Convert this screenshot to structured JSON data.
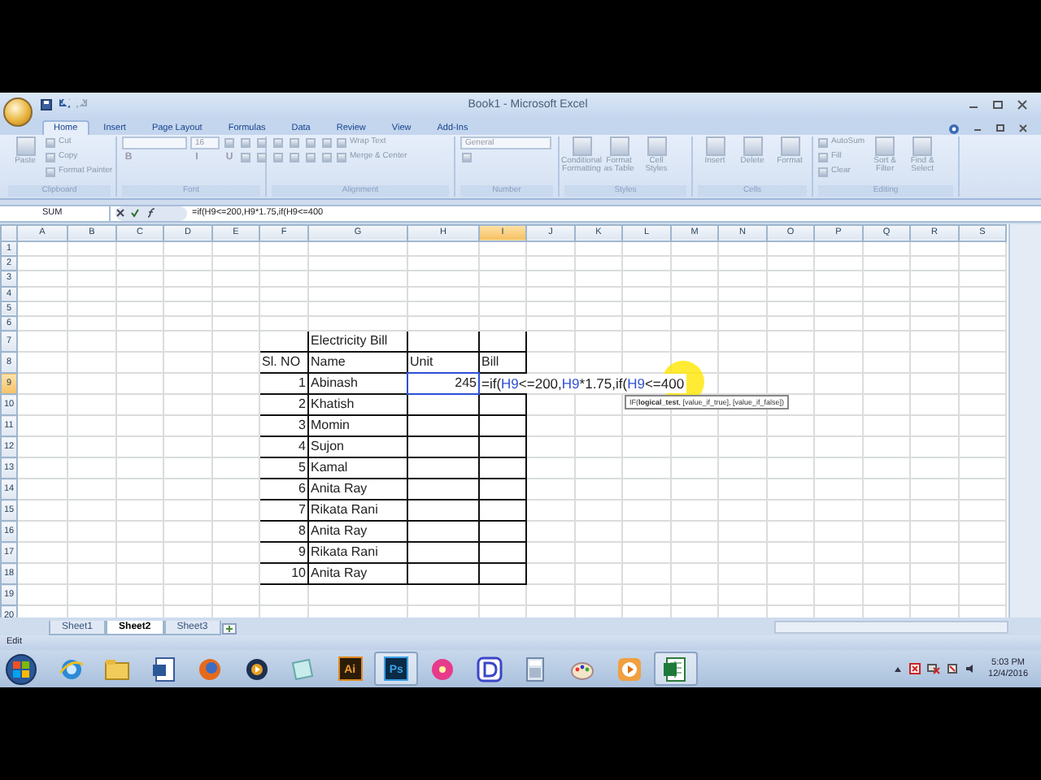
{
  "window": {
    "title": "Book1 - Microsoft Excel"
  },
  "ribbon_tabs": [
    {
      "label": "Home",
      "selected": true
    },
    {
      "label": "Insert",
      "selected": false
    },
    {
      "label": "Page Layout",
      "selected": false
    },
    {
      "label": "Formulas",
      "selected": false
    },
    {
      "label": "Data",
      "selected": false
    },
    {
      "label": "Review",
      "selected": false
    },
    {
      "label": "View",
      "selected": false
    },
    {
      "label": "Add-Ins",
      "selected": false
    }
  ],
  "ribbon_groups": [
    {
      "label": "Clipboard",
      "columns": [
        [
          {
            "kind": "large",
            "label": "Paste"
          }
        ],
        [
          {
            "kind": "small",
            "label": "Cut"
          },
          {
            "kind": "small",
            "label": "Copy"
          },
          {
            "kind": "small",
            "label": "Format Painter"
          }
        ]
      ]
    },
    {
      "label": "Font",
      "columns": [
        [
          {
            "kind": "field"
          },
          {
            "kind": "glyph",
            "label": "B"
          }
        ],
        [
          {
            "kind": "field",
            "label": "16"
          },
          {
            "kind": "glyph",
            "label": "I"
          }
        ],
        [
          {
            "kind": "icon"
          },
          {
            "kind": "glyph",
            "label": "U"
          }
        ],
        [
          {
            "kind": "icon"
          },
          {
            "kind": "icon"
          }
        ],
        [
          {
            "kind": "icon"
          },
          {
            "kind": "icon"
          }
        ]
      ]
    },
    {
      "label": "Alignment",
      "columns": [
        [
          {
            "kind": "icon"
          },
          {
            "kind": "icon"
          }
        ],
        [
          {
            "kind": "icon"
          },
          {
            "kind": "icon"
          }
        ],
        [
          {
            "kind": "icon"
          },
          {
            "kind": "icon"
          }
        ],
        [
          {
            "kind": "icon"
          },
          {
            "kind": "icon"
          }
        ],
        [
          {
            "kind": "small",
            "label": "Wrap Text"
          },
          {
            "kind": "small",
            "label": "Merge & Center"
          }
        ]
      ]
    },
    {
      "label": "Number",
      "columns": [
        [
          {
            "kind": "field",
            "label": "General"
          },
          {
            "kind": "icon"
          }
        ]
      ]
    },
    {
      "label": "Styles",
      "columns": [
        [
          {
            "kind": "large",
            "label": "Conditional Formatting"
          }
        ],
        [
          {
            "kind": "large",
            "label": "Format as Table"
          }
        ],
        [
          {
            "kind": "large",
            "label": "Cell Styles"
          }
        ]
      ]
    },
    {
      "label": "Cells",
      "columns": [
        [
          {
            "kind": "large",
            "label": "Insert"
          }
        ],
        [
          {
            "kind": "large",
            "label": "Delete"
          }
        ],
        [
          {
            "kind": "large",
            "label": "Format"
          }
        ]
      ]
    },
    {
      "label": "Editing",
      "columns": [
        [
          {
            "kind": "small",
            "label": "AutoSum"
          },
          {
            "kind": "small",
            "label": "Fill"
          },
          {
            "kind": "small",
            "label": "Clear"
          }
        ],
        [
          {
            "kind": "large",
            "label": "Sort & Filter"
          }
        ],
        [
          {
            "kind": "large",
            "label": "Find & Select"
          }
        ]
      ]
    }
  ],
  "formula_bar": {
    "name_box": "SUM",
    "formula": "=if(H9<=200,H9*1.75,if(H9<=400"
  },
  "sheet": {
    "columns": [
      {
        "label": "A",
        "selected": false
      },
      {
        "label": "B",
        "selected": false
      },
      {
        "label": "C",
        "selected": false
      },
      {
        "label": "D",
        "selected": false
      },
      {
        "label": "E",
        "selected": false
      },
      {
        "label": "F",
        "selected": false
      },
      {
        "label": "G",
        "selected": false
      },
      {
        "label": "H",
        "selected": false
      },
      {
        "label": "I",
        "selected": true
      },
      {
        "label": "J",
        "selected": false
      },
      {
        "label": "K",
        "selected": false
      },
      {
        "label": "L",
        "selected": false
      },
      {
        "label": "M",
        "selected": false
      },
      {
        "label": "N",
        "selected": false
      },
      {
        "label": "O",
        "selected": false
      },
      {
        "label": "P",
        "selected": false
      },
      {
        "label": "Q",
        "selected": false
      },
      {
        "label": "R",
        "selected": false
      },
      {
        "label": "S",
        "selected": false
      }
    ],
    "rows": [
      {
        "label": "1",
        "selected": false,
        "bordered": false,
        "cells": {}
      },
      {
        "label": "2",
        "selected": false,
        "bordered": false,
        "cells": {}
      },
      {
        "label": "3",
        "selected": false,
        "bordered": false,
        "cells": {}
      },
      {
        "label": "4",
        "selected": false,
        "bordered": false,
        "cells": {}
      },
      {
        "label": "5",
        "selected": false,
        "bordered": false,
        "cells": {}
      },
      {
        "label": "6",
        "selected": false,
        "bordered": false,
        "cells": {}
      },
      {
        "label": "7",
        "selected": false,
        "bordered": true,
        "cells": {
          "G": "Electricity Bill"
        }
      },
      {
        "label": "8",
        "selected": false,
        "bordered": true,
        "cells": {
          "F": "Sl. NO",
          "G": "Name",
          "H": "Unit",
          "I": "Bill"
        }
      },
      {
        "label": "9",
        "selected": true,
        "bordered": true,
        "cells": {
          "F": "1",
          "G": "Abinash",
          "H": {
            "text": "245",
            "referenced": true
          },
          "I": {
            "formula_parts": [
              {
                "kind": "text",
                "text": "=if("
              },
              {
                "kind": "ref",
                "text": "H9"
              },
              {
                "kind": "text",
                "text": "<=200,"
              },
              {
                "kind": "ref",
                "text": "H9"
              },
              {
                "kind": "text",
                "text": "*1.75,if("
              },
              {
                "kind": "ref",
                "text": "H9"
              },
              {
                "kind": "text",
                "text": "<=400"
              }
            ],
            "tooltip": "IF(**logical_test**, [value_if_true], [value_if_false])"
          }
        }
      },
      {
        "label": "10",
        "selected": false,
        "bordered": true,
        "cells": {
          "F": "2",
          "G": "Khatish"
        }
      },
      {
        "label": "11",
        "selected": false,
        "bordered": true,
        "cells": {
          "F": "3",
          "G": "Momin"
        }
      },
      {
        "label": "12",
        "selected": false,
        "bordered": true,
        "cells": {
          "F": "4",
          "G": "Sujon"
        }
      },
      {
        "label": "13",
        "selected": false,
        "bordered": true,
        "cells": {
          "F": "5",
          "G": "Kamal"
        }
      },
      {
        "label": "14",
        "selected": false,
        "bordered": true,
        "cells": {
          "F": "6",
          "G": "Anita Ray"
        }
      },
      {
        "label": "15",
        "selected": false,
        "bordered": true,
        "cells": {
          "F": "7",
          "G": "Rikata Rani"
        }
      },
      {
        "label": "16",
        "selected": false,
        "bordered": true,
        "cells": {
          "F": "8",
          "G": "Anita Ray"
        }
      },
      {
        "label": "17",
        "selected": false,
        "bordered": true,
        "cells": {
          "F": "9",
          "G": "Rikata Rani"
        }
      },
      {
        "label": "18",
        "selected": false,
        "bordered": true,
        "cells": {
          "F": "10",
          "G": "Anita Ray"
        }
      },
      {
        "label": "19",
        "selected": false,
        "bordered": false,
        "cells": {}
      },
      {
        "label": "20",
        "selected": false,
        "bordered": false,
        "cells": {}
      }
    ]
  },
  "sheet_tabs": [
    {
      "label": "Sheet1",
      "selected": false
    },
    {
      "label": "Sheet2",
      "selected": true
    },
    {
      "label": "Sheet3",
      "selected": false
    }
  ],
  "status_bar": {
    "mode": "Edit"
  },
  "taskbar": {
    "apps": [
      {
        "kind": "ie",
        "active": false
      },
      {
        "kind": "folder",
        "active": false
      },
      {
        "kind": "word",
        "active": false
      },
      {
        "kind": "firefox",
        "active": false
      },
      {
        "kind": "media",
        "active": false
      },
      {
        "kind": "notes",
        "active": false
      },
      {
        "kind": "label",
        "label": "Ai",
        "color": "#2b1c08",
        "active": false
      },
      {
        "kind": "label",
        "label": "Ps",
        "color": "#0b2a45",
        "active": true
      },
      {
        "kind": "flower",
        "active": false
      },
      {
        "kind": "d",
        "active": false
      },
      {
        "kind": "calc",
        "active": false
      },
      {
        "kind": "paint",
        "active": false
      },
      {
        "kind": "player",
        "active": false
      },
      {
        "kind": "excel",
        "active": true
      }
    ],
    "time": "5:03 PM",
    "date": "12/4/2016"
  }
}
